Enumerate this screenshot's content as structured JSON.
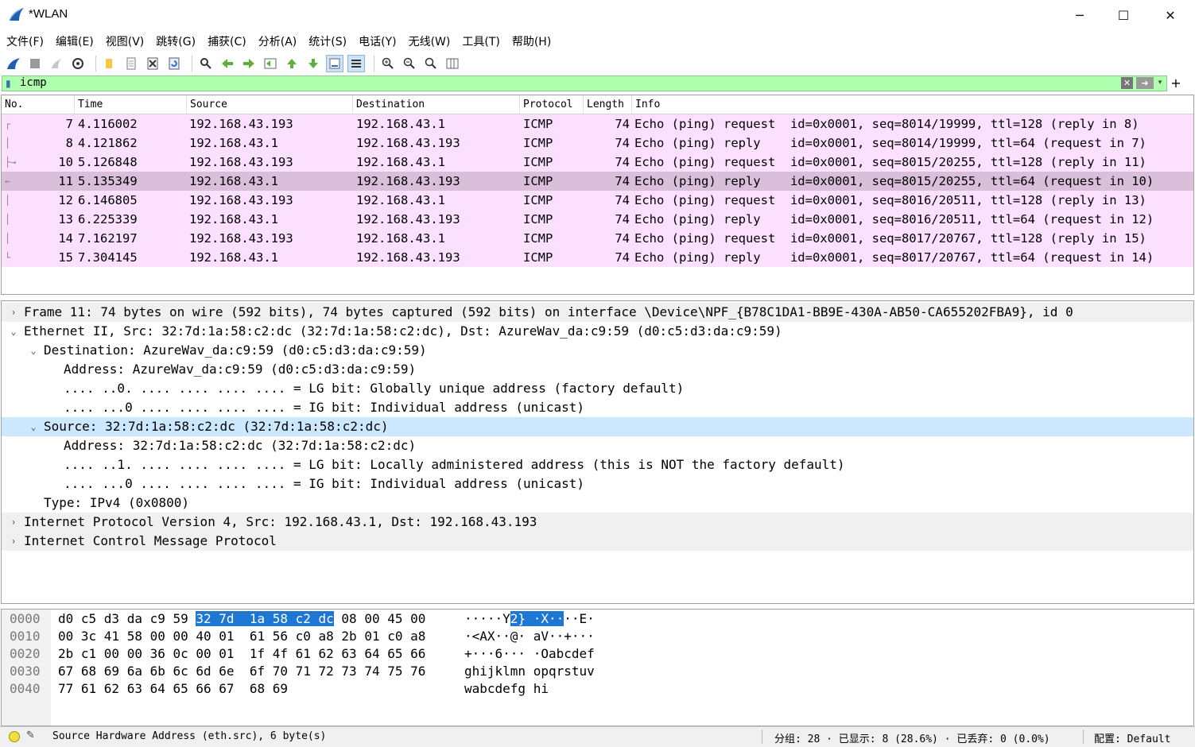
{
  "window": {
    "title": "*WLAN",
    "minimize": "─",
    "maximize": "☐",
    "close": "✕"
  },
  "menu": [
    "文件(F)",
    "编辑(E)",
    "视图(V)",
    "跳转(G)",
    "捕获(C)",
    "分析(A)",
    "统计(S)",
    "电话(Y)",
    "无线(W)",
    "工具(T)",
    "帮助(H)"
  ],
  "toolbar_icons": [
    "shark-fin-start-icon",
    "stop-icon",
    "restart-icon",
    "capture-options-icon",
    "open-folder-icon",
    "open-file-icon",
    "close-file-icon",
    "reload-icon",
    "find-icon",
    "back-arrow-icon",
    "forward-arrow-icon",
    "goto-packet-icon",
    "first-packet-icon",
    "last-packet-icon",
    "autoscroll-icon",
    "colorize-icon",
    "zoom-in-icon",
    "zoom-out-icon",
    "zoom-normal-icon",
    "resize-columns-icon"
  ],
  "filter": {
    "value": "icmp",
    "plus": "+"
  },
  "packet_list": {
    "columns": [
      "No.",
      "Time",
      "Source",
      "Destination",
      "Protocol",
      "Length",
      "Info"
    ],
    "rows": [
      {
        "no": "7",
        "time": "4.116002",
        "src": "192.168.43.193",
        "dst": "192.168.43.1",
        "proto": "ICMP",
        "len": "74",
        "info": "Echo (ping) request  id=0x0001, seq=8014/19999, ttl=128 (reply in 8)",
        "rel": "┌"
      },
      {
        "no": "8",
        "time": "4.121862",
        "src": "192.168.43.1",
        "dst": "192.168.43.193",
        "proto": "ICMP",
        "len": "74",
        "info": "Echo (ping) reply    id=0x0001, seq=8014/19999, ttl=64 (request in 7)",
        "rel": "│"
      },
      {
        "no": "10",
        "time": "5.126848",
        "src": "192.168.43.193",
        "dst": "192.168.43.1",
        "proto": "ICMP",
        "len": "74",
        "info": "Echo (ping) request  id=0x0001, seq=8015/20255, ttl=128 (reply in 11)",
        "rel": "├→"
      },
      {
        "no": "11",
        "time": "5.135349",
        "src": "192.168.43.1",
        "dst": "192.168.43.193",
        "proto": "ICMP",
        "len": "74",
        "info": "Echo (ping) reply    id=0x0001, seq=8015/20255, ttl=64 (request in 10)",
        "rel": "←"
      },
      {
        "no": "12",
        "time": "6.146805",
        "src": "192.168.43.193",
        "dst": "192.168.43.1",
        "proto": "ICMP",
        "len": "74",
        "info": "Echo (ping) request  id=0x0001, seq=8016/20511, ttl=128 (reply in 13)",
        "rel": "│"
      },
      {
        "no": "13",
        "time": "6.225339",
        "src": "192.168.43.1",
        "dst": "192.168.43.193",
        "proto": "ICMP",
        "len": "74",
        "info": "Echo (ping) reply    id=0x0001, seq=8016/20511, ttl=64 (request in 12)",
        "rel": "│"
      },
      {
        "no": "14",
        "time": "7.162197",
        "src": "192.168.43.193",
        "dst": "192.168.43.1",
        "proto": "ICMP",
        "len": "74",
        "info": "Echo (ping) request  id=0x0001, seq=8017/20767, ttl=128 (reply in 15)",
        "rel": "│"
      },
      {
        "no": "15",
        "time": "7.304145",
        "src": "192.168.43.1",
        "dst": "192.168.43.193",
        "proto": "ICMP",
        "len": "74",
        "info": "Echo (ping) reply    id=0x0001, seq=8017/20767, ttl=64 (request in 14)",
        "rel": "└"
      }
    ],
    "selected_index": 3,
    "row_color": "#fce0ff"
  },
  "details": [
    {
      "text": "Frame 11: 74 bytes on wire (592 bits), 74 bytes captured (592 bits) on interface \\Device\\NPF_{B78C1DA1-BB9E-430A-AB50-CA655202FBA9}, id 0",
      "level": 0,
      "chev": "›",
      "style": "shade"
    },
    {
      "text": "Ethernet II, Src: 32:7d:1a:58:c2:dc (32:7d:1a:58:c2:dc), Dst: AzureWav_da:c9:59 (d0:c5:d3:da:c9:59)",
      "level": 0,
      "chev": "⌄",
      "style": ""
    },
    {
      "text": "Destination: AzureWav_da:c9:59 (d0:c5:d3:da:c9:59)",
      "level": 1,
      "chev": "⌄",
      "style": ""
    },
    {
      "text": "Address: AzureWav_da:c9:59 (d0:c5:d3:da:c9:59)",
      "level": 2,
      "chev": "",
      "style": ""
    },
    {
      "text": ".... ..0. .... .... .... .... = LG bit: Globally unique address (factory default)",
      "level": 2,
      "chev": "",
      "style": ""
    },
    {
      "text": ".... ...0 .... .... .... .... = IG bit: Individual address (unicast)",
      "level": 2,
      "chev": "",
      "style": ""
    },
    {
      "text": "Source: 32:7d:1a:58:c2:dc (32:7d:1a:58:c2:dc)",
      "level": 1,
      "chev": "⌄",
      "style": "sel"
    },
    {
      "text": "Address: 32:7d:1a:58:c2:dc (32:7d:1a:58:c2:dc)",
      "level": 2,
      "chev": "",
      "style": ""
    },
    {
      "text": ".... ..1. .... .... .... .... = LG bit: Locally administered address (this is NOT the factory default)",
      "level": 2,
      "chev": "",
      "style": ""
    },
    {
      "text": ".... ...0 .... .... .... .... = IG bit: Individual address (unicast)",
      "level": 2,
      "chev": "",
      "style": ""
    },
    {
      "text": "Type: IPv4 (0x0800)",
      "level": 1,
      "chev": "",
      "style": ""
    },
    {
      "text": "Internet Protocol Version 4, Src: 192.168.43.1, Dst: 192.168.43.193",
      "level": 0,
      "chev": "›",
      "style": "shade"
    },
    {
      "text": "Internet Control Message Protocol",
      "level": 0,
      "chev": "›",
      "style": "shade"
    }
  ],
  "bytes": [
    {
      "offset": "0000",
      "hex_pre": "d0 c5 d3 da c9 59 ",
      "hex_hl": "32 7d  1a 58 c2 dc",
      "hex_post": " 08 00 45 00",
      "ascii_pre": "·····Y",
      "ascii_hl": "2} ·X··",
      "ascii_post": "··E·"
    },
    {
      "offset": "0010",
      "hex_pre": "00 3c 41 58 00 00 40 01  61 56 c0 a8 2b 01 c0 a8",
      "hex_hl": "",
      "hex_post": "",
      "ascii_pre": "·<AX··@· aV··+···",
      "ascii_hl": "",
      "ascii_post": ""
    },
    {
      "offset": "0020",
      "hex_pre": "2b c1 00 00 36 0c 00 01  1f 4f 61 62 63 64 65 66",
      "hex_hl": "",
      "hex_post": "",
      "ascii_pre": "+···6··· ·Oabcdef",
      "ascii_hl": "",
      "ascii_post": ""
    },
    {
      "offset": "0030",
      "hex_pre": "67 68 69 6a 6b 6c 6d 6e  6f 70 71 72 73 74 75 76",
      "hex_hl": "",
      "hex_post": "",
      "ascii_pre": "ghijklmn opqrstuv",
      "ascii_hl": "",
      "ascii_post": ""
    },
    {
      "offset": "0040",
      "hex_pre": "77 61 62 63 64 65 66 67  68 69",
      "hex_hl": "",
      "hex_post": "",
      "ascii_pre": "wabcdefg hi",
      "ascii_hl": "",
      "ascii_post": ""
    }
  ],
  "status": {
    "field": "Source Hardware Address (eth.src), 6 byte(s)",
    "stats": "分组: 28 · 已显示: 8 (28.6%) · 已丢弃: 0 (0.0%)",
    "profile": "配置: Default",
    "led_color": "#f0e040"
  }
}
